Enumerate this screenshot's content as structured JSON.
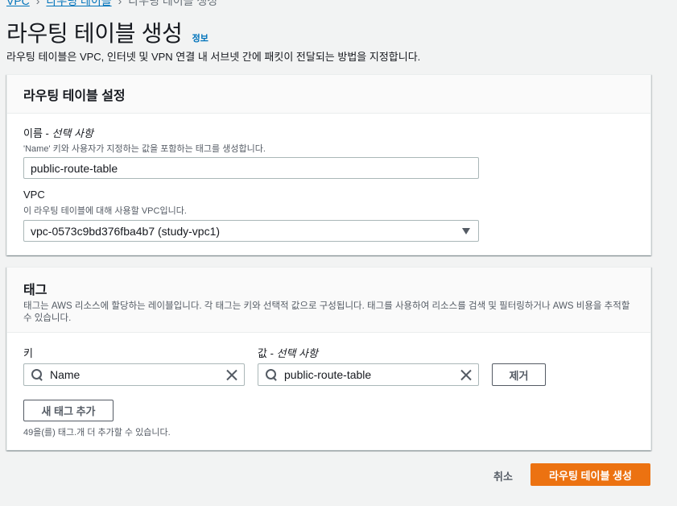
{
  "breadcrumb": {
    "items": [
      "VPC",
      "라우팅 테이블",
      "라우팅 테이블 생성"
    ]
  },
  "header": {
    "title": "라우팅 테이블 생성",
    "info_link": "정보",
    "description": "라우팅 테이블은 VPC, 인터넷 및 VPN 연결 내 서브넷 간에 패킷이 전달되는 방법을 지정합니다."
  },
  "settings": {
    "title": "라우팅 테이블 설정",
    "name_label": "이름 - ",
    "name_optional": "선택 사항",
    "name_hint": "'Name' 키와 사용자가 지정하는 값을 포함하는 태그를 생성합니다.",
    "name_value": "public-route-table",
    "vpc_label": "VPC",
    "vpc_hint": "이 라우팅 테이블에 대해 사용할 VPC입니다.",
    "vpc_value": "vpc-0573c9bd376fba4b7 (study-vpc1)"
  },
  "tags": {
    "title": "태그",
    "description": "태그는 AWS 리소스에 할당하는 레이블입니다. 각 태그는 키와 선택적 값으로 구성됩니다. 태그를 사용하여 리소스를 검색 및 필터링하거나 AWS 비용을 추적할 수 있습니다.",
    "key_label": "키",
    "value_label": "값 - ",
    "value_optional": "선택 사항",
    "key_value": "Name",
    "value_value": "public-route-table",
    "remove_button": "제거",
    "add_button": "새 태그 추가",
    "remaining_text": "49을(를) 태그.개 더 추가할 수 있습니다."
  },
  "footer": {
    "cancel_button": "취소",
    "create_button": "라우팅 테이블 생성"
  },
  "colors": {
    "primary": "#ec7211",
    "link": "#0073bb",
    "background": "#f2f3f3"
  }
}
